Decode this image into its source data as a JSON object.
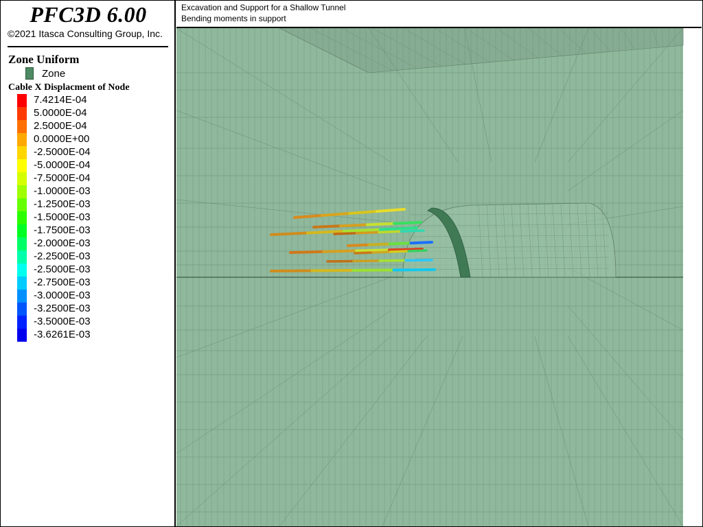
{
  "app": {
    "title": "PFC3D 6.00",
    "copyright": "©2021 Itasca Consulting Group, Inc."
  },
  "plot_titles": [
    "Excavation and Support for a Shallow Tunnel",
    "Bending moments in support"
  ],
  "legend": {
    "zone_heading": "Zone Uniform",
    "zone_item": "Zone",
    "zone_color": "#4e8a63",
    "cable_heading": "Cable X Displacment of Node",
    "scale": [
      {
        "label": "7.4214E-04",
        "color": "#ff0000"
      },
      {
        "label": "5.0000E-04",
        "color": "#ff3a00"
      },
      {
        "label": "2.5000E-04",
        "color": "#ff7000"
      },
      {
        "label": "0.0000E+00",
        "color": "#ffa800"
      },
      {
        "label": "-2.5000E-04",
        "color": "#ffd600"
      },
      {
        "label": "-5.0000E-04",
        "color": "#ffff00"
      },
      {
        "label": "-7.5000E-04",
        "color": "#d4ff00"
      },
      {
        "label": "-1.0000E-03",
        "color": "#a0ff00"
      },
      {
        "label": "-1.2500E-03",
        "color": "#66ff00"
      },
      {
        "label": "-1.5000E-03",
        "color": "#2aff00"
      },
      {
        "label": "-1.7500E-03",
        "color": "#00ff22"
      },
      {
        "label": "-2.0000E-03",
        "color": "#00ff66"
      },
      {
        "label": "-2.2500E-03",
        "color": "#00ffaa"
      },
      {
        "label": "-2.5000E-03",
        "color": "#00ffee"
      },
      {
        "label": "-2.7500E-03",
        "color": "#00ccff"
      },
      {
        "label": "-3.0000E-03",
        "color": "#0090ff"
      },
      {
        "label": "-3.2500E-03",
        "color": "#0055ff"
      },
      {
        "label": "-3.5000E-03",
        "color": "#0022ff"
      },
      {
        "label": "-3.6261E-03",
        "color": "#0000ee"
      }
    ]
  },
  "scene": {
    "zone_fill": "#8fb89c",
    "mesh_line": "#5e7f68",
    "liner_color": "#3f7a55",
    "cables": [
      {
        "segments": [
          "#d98a1c",
          "#d9a51c",
          "#d9c41c",
          "#e8dc2a"
        ]
      },
      {
        "segments": [
          "#c8781a",
          "#d4a020",
          "#c8e030",
          "#39e060"
        ]
      },
      {
        "segments": [
          "#d08c1c",
          "#d4b81c",
          "#a8e030",
          "#2ee08a"
        ]
      },
      {
        "segments": [
          "#c06a18",
          "#d49a20",
          "#c0d82a",
          "#30d8b0"
        ]
      },
      {
        "segments": [
          "#d88a1c",
          "#c8b020",
          "#6ae040",
          "#1a70ff"
        ]
      },
      {
        "segments": [
          "#d07818",
          "#d4a020",
          "#c8e030",
          "#e04020"
        ]
      },
      {
        "segments": [
          "#c07018",
          "#cca020",
          "#a8e030",
          "#28c8ff"
        ]
      },
      {
        "segments": [
          "#d08c1c",
          "#d4b81c",
          "#9ae030",
          "#10c8f0"
        ]
      },
      {
        "segments": [
          "#c8781a",
          "#d0a820",
          "#d4cc1c",
          "#3ad060"
        ]
      }
    ]
  }
}
